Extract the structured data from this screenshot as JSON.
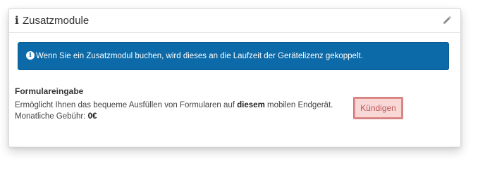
{
  "header": {
    "info_icon": "info-icon",
    "title": "Zusatzmodule",
    "edit_icon": "pencil-icon"
  },
  "alert": {
    "icon": "info-circle-icon",
    "text": "Wenn Sie ein Zusatzmodul buchen, wird dieses an die Laufzeit der Gerätelizenz gekoppelt.",
    "color": "#0c6aa8"
  },
  "module": {
    "title": "Formulareingabe",
    "desc_before": "Ermöglicht Ihnen das bequeme Ausfüllen von Formularen auf ",
    "desc_bold": "diesem",
    "desc_after": " mobilen Endgerät.",
    "fee_label": "Monatliche Gebühr: ",
    "fee_value": "0€",
    "cancel_label": "Kündigen",
    "cancel_color": "#f8d7d7"
  }
}
